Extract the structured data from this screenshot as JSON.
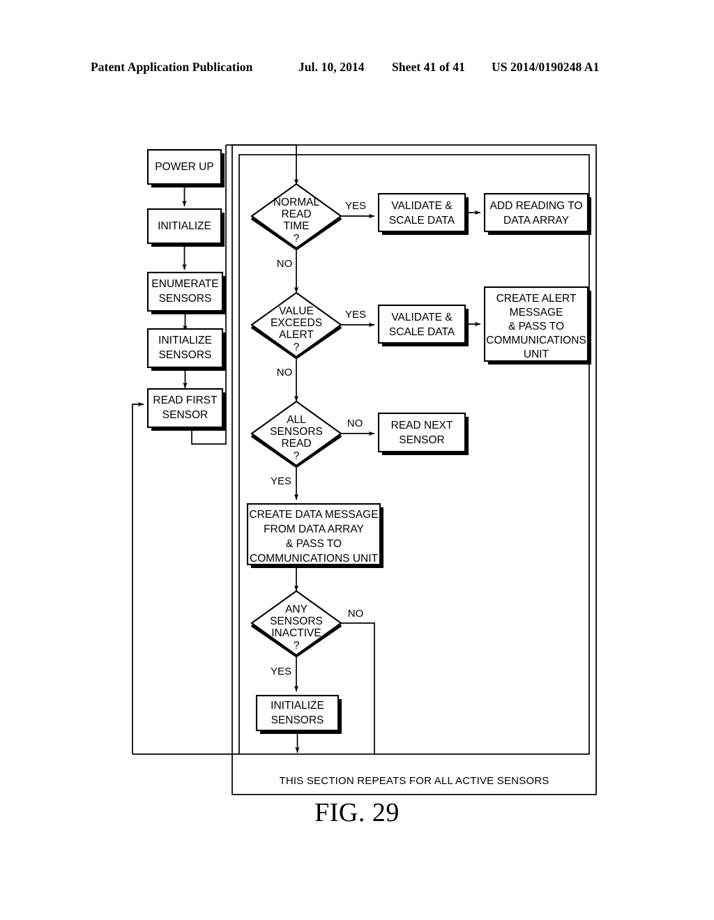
{
  "header": {
    "publication": "Patent Application Publication",
    "date": "Jul. 10, 2014",
    "sheet": "Sheet 41 of 41",
    "patent_number": "US 2014/0190248 A1"
  },
  "figure": {
    "label": "FIG. 29",
    "section_note": "THIS SECTION REPEATS FOR ALL ACTIVE SENSORS"
  },
  "chart_data": {
    "type": "diagram",
    "diagram_kind": "flowchart",
    "title": "FIG. 29",
    "nodes": [
      {
        "id": "power_up",
        "shape": "process",
        "text": [
          "POWER UP"
        ]
      },
      {
        "id": "initialize",
        "shape": "process",
        "text": [
          "INITIALIZE"
        ]
      },
      {
        "id": "enumerate",
        "shape": "process",
        "text": [
          "ENUMERATE",
          "SENSORS"
        ]
      },
      {
        "id": "init_sensors",
        "shape": "process",
        "text": [
          "INITIALIZE",
          "SENSORS"
        ]
      },
      {
        "id": "read_first",
        "shape": "process",
        "text": [
          "READ FIRST",
          "SENSOR"
        ]
      },
      {
        "id": "normal_read",
        "shape": "decision",
        "text": [
          "NORMAL",
          "READ",
          "TIME",
          "?"
        ]
      },
      {
        "id": "validate1",
        "shape": "process",
        "text": [
          "VALIDATE &",
          "SCALE DATA"
        ]
      },
      {
        "id": "add_reading",
        "shape": "process",
        "text": [
          "ADD READING TO",
          "DATA ARRAY"
        ]
      },
      {
        "id": "value_exceeds",
        "shape": "decision",
        "text": [
          "VALUE",
          "EXCEEDS",
          "ALERT",
          "?"
        ]
      },
      {
        "id": "validate2",
        "shape": "process",
        "text": [
          "VALIDATE &",
          "SCALE DATA"
        ]
      },
      {
        "id": "create_alert",
        "shape": "process",
        "text": [
          "CREATE ALERT",
          "MESSAGE",
          "& PASS TO",
          "COMMUNICATIONS",
          "UNIT"
        ]
      },
      {
        "id": "all_sensors",
        "shape": "decision",
        "text": [
          "ALL",
          "SENSORS",
          "READ",
          "?"
        ]
      },
      {
        "id": "read_next",
        "shape": "process",
        "text": [
          "READ NEXT",
          "SENSOR"
        ]
      },
      {
        "id": "create_data_msg",
        "shape": "process",
        "text": [
          "CREATE DATA MESSAGE",
          "FROM DATA ARRAY",
          "& PASS TO",
          "COMMUNICATIONS UNIT"
        ]
      },
      {
        "id": "any_inactive",
        "shape": "decision",
        "text": [
          "ANY",
          "SENSORS",
          "INACTIVE",
          "?"
        ]
      },
      {
        "id": "init_sensors2",
        "shape": "process",
        "text": [
          "INITIALIZE",
          "SENSORS"
        ]
      }
    ],
    "edges": [
      {
        "from": "power_up",
        "to": "initialize",
        "label": ""
      },
      {
        "from": "initialize",
        "to": "enumerate",
        "label": ""
      },
      {
        "from": "enumerate",
        "to": "init_sensors",
        "label": ""
      },
      {
        "from": "init_sensors",
        "to": "read_first",
        "label": ""
      },
      {
        "from": "read_first",
        "to": "normal_read",
        "label": ""
      },
      {
        "from": "normal_read",
        "to": "validate1",
        "label": "YES"
      },
      {
        "from": "validate1",
        "to": "add_reading",
        "label": ""
      },
      {
        "from": "normal_read",
        "to": "value_exceeds",
        "label": "NO"
      },
      {
        "from": "value_exceeds",
        "to": "validate2",
        "label": "YES"
      },
      {
        "from": "validate2",
        "to": "create_alert",
        "label": ""
      },
      {
        "from": "value_exceeds",
        "to": "all_sensors",
        "label": "NO"
      },
      {
        "from": "all_sensors",
        "to": "read_next",
        "label": "NO"
      },
      {
        "from": "all_sensors",
        "to": "create_data_msg",
        "label": "YES"
      },
      {
        "from": "create_data_msg",
        "to": "any_inactive",
        "label": ""
      },
      {
        "from": "any_inactive",
        "to": "init_sensors2",
        "label": "YES"
      },
      {
        "from": "any_inactive",
        "to": "loop_bottom",
        "label": "NO"
      },
      {
        "from": "init_sensors2",
        "to": "loop_bottom",
        "label": ""
      },
      {
        "from": "loop_bottom",
        "to": "read_first",
        "label": ""
      }
    ],
    "edge_labels": {
      "yes1": "YES",
      "no1": "NO",
      "yes2": "YES",
      "no2": "NO",
      "no3": "NO",
      "yes3": "YES",
      "no4": "NO",
      "yes4": "YES"
    },
    "annotations": [
      "THIS SECTION REPEATS FOR ALL ACTIVE SENSORS"
    ],
    "colors": {
      "stroke": "#000000",
      "fill": "#ffffff",
      "background": "#ffffff"
    }
  }
}
